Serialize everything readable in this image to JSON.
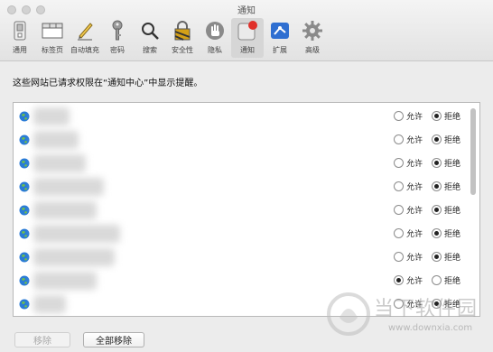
{
  "window": {
    "title": "通知"
  },
  "toolbar": {
    "items": [
      {
        "label": "通用",
        "icon": "switch-icon"
      },
      {
        "label": "标签页",
        "icon": "tabs-icon"
      },
      {
        "label": "自动填充",
        "icon": "pencil-icon"
      },
      {
        "label": "密码",
        "icon": "key-icon"
      },
      {
        "label": "搜索",
        "icon": "magnifier-icon"
      },
      {
        "label": "安全性",
        "icon": "lock-icon"
      },
      {
        "label": "隐私",
        "icon": "hand-icon"
      },
      {
        "label": "通知",
        "icon": "notification-badge-icon",
        "active": true
      },
      {
        "label": "扩展",
        "icon": "puzzle-icon"
      },
      {
        "label": "高级",
        "icon": "gear-icon"
      }
    ]
  },
  "prompt": "这些网站已请求权限在“通知中心”中显示提醒。",
  "permission": {
    "allow_label": "允许",
    "deny_label": "拒绝",
    "rows": [
      {
        "state": "deny"
      },
      {
        "state": "deny"
      },
      {
        "state": "deny"
      },
      {
        "state": "deny"
      },
      {
        "state": "deny"
      },
      {
        "state": "deny"
      },
      {
        "state": "deny"
      },
      {
        "state": "allow"
      },
      {
        "state": "deny"
      }
    ]
  },
  "buttons": {
    "remove": "移除",
    "remove_all": "全部移除"
  },
  "watermark": {
    "brand": "当下软件园",
    "url": "www.downxia.com"
  },
  "colors": {
    "globe": "#2a7bd6",
    "badge": "#e0302a"
  }
}
